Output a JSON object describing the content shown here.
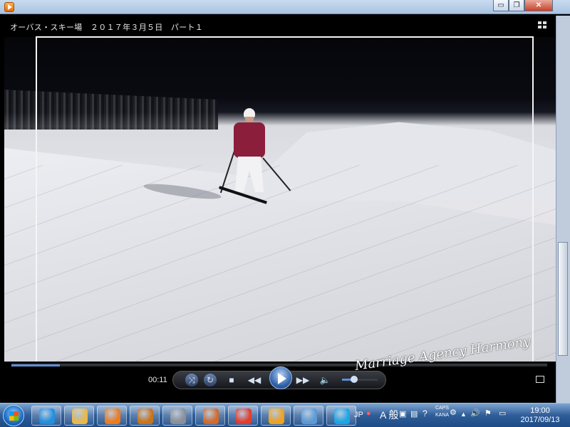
{
  "window": {
    "minimize_label": "▭",
    "restore_label": "❐",
    "close_label": "✕"
  },
  "player": {
    "video_title": "オーバス・スキー場　２０１７年３月５日　パート１",
    "current_time": "00:11",
    "progress_fraction": 0.09,
    "volume_fraction": 0.35,
    "watermark_text": "Marriage Agency Harmony"
  },
  "taskbar": {
    "items": [
      {
        "name": "internet-explorer",
        "color": "#1f8fe0"
      },
      {
        "name": "file-explorer",
        "color": "#e7b94a"
      },
      {
        "name": "windows-media-player",
        "color": "#ef7a1a"
      },
      {
        "name": "media-app",
        "color": "#c9741a"
      },
      {
        "name": "camera-app",
        "color": "#8a8f98"
      },
      {
        "name": "edit-app",
        "color": "#d26a2a"
      },
      {
        "name": "video-app",
        "color": "#e23c2c"
      },
      {
        "name": "audio-app",
        "color": "#f0a21a"
      },
      {
        "name": "paint-app",
        "color": "#5a9ad6"
      },
      {
        "name": "skype",
        "color": "#19a6e6"
      }
    ],
    "language": "JP",
    "ime_mode": "A 般",
    "caps_label": "CAPS",
    "kana_label": "KANA",
    "time": "19:00",
    "date": "2017/09/13"
  }
}
